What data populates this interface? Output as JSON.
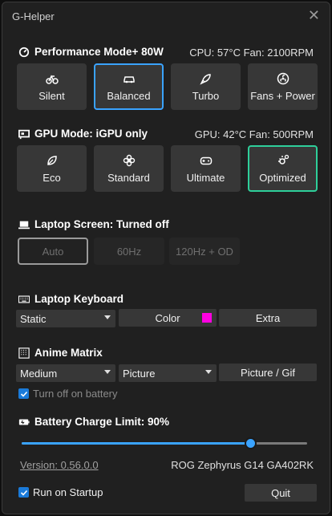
{
  "window": {
    "title": "G-Helper"
  },
  "performance": {
    "title": "Performance Mode+ 80W",
    "status": "CPU: 57°C  Fan: 2100RPM",
    "modes": [
      {
        "label": "Silent",
        "icon": "bike-icon",
        "selected": false
      },
      {
        "label": "Balanced",
        "icon": "car-icon",
        "selected": true
      },
      {
        "label": "Turbo",
        "icon": "rocket-icon",
        "selected": false
      },
      {
        "label": "Fans + Power",
        "icon": "fan-icon",
        "selected": false
      }
    ]
  },
  "gpu": {
    "title": "GPU Mode: iGPU only",
    "status": "GPU: 42°C  Fan: 500RPM",
    "modes": [
      {
        "label": "Eco",
        "icon": "leaf-icon",
        "selected": false
      },
      {
        "label": "Standard",
        "icon": "flower-icon",
        "selected": false
      },
      {
        "label": "Ultimate",
        "icon": "gamepad-icon",
        "selected": false
      },
      {
        "label": "Optimized",
        "icon": "sun-gear-icon",
        "selected": true
      }
    ]
  },
  "screen": {
    "title": "Laptop Screen: Turned off",
    "rates": [
      {
        "label": "Auto",
        "selected": true
      },
      {
        "label": "60Hz",
        "selected": false
      },
      {
        "label": "120Hz + OD",
        "selected": false
      }
    ]
  },
  "keyboard": {
    "title": "Laptop Keyboard",
    "mode": "Static",
    "color_label": "Color",
    "color_value": "#ff00e1",
    "extra_label": "Extra"
  },
  "anime": {
    "title": "Anime Matrix",
    "brightness": "Medium",
    "mode": "Picture",
    "picture_label": "Picture / Gif",
    "battery_off_label": "Turn off on battery",
    "battery_off_checked": true
  },
  "battery": {
    "title": "Battery Charge Limit: 90%",
    "limit_fraction": 0.8
  },
  "footer": {
    "version": "Version: 0.56.0.0",
    "model": "ROG Zephyrus G14 GA402RK",
    "startup_label": "Run on Startup",
    "startup_checked": true,
    "quit_label": "Quit"
  },
  "colors": {
    "accent_blue": "#3aa3ff",
    "accent_green": "#2ecf9a",
    "keyboard_color": "#ff00e1"
  }
}
